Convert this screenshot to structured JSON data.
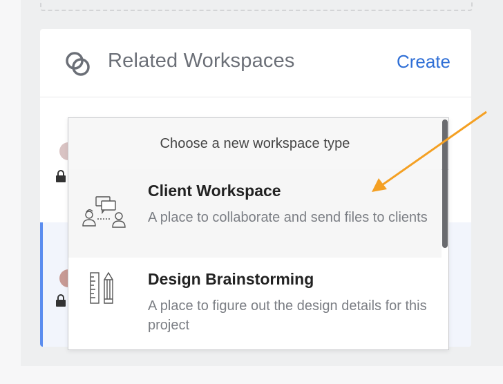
{
  "card": {
    "title": "Related Workspaces",
    "create_label": "Create"
  },
  "dropdown": {
    "header": "Choose a new workspace type",
    "options": [
      {
        "title": "Client Workspace",
        "description": "A place to collaborate and send files to clients",
        "icon": "chat-people-icon"
      },
      {
        "title": "Design Brainstorming",
        "description": "A place to figure out the design details for this project",
        "icon": "ruler-pencil-icon"
      }
    ]
  },
  "colors": {
    "accent": "#2f6fd6",
    "annotation_arrow": "#f4a023",
    "active_bar": "#5b8def"
  }
}
